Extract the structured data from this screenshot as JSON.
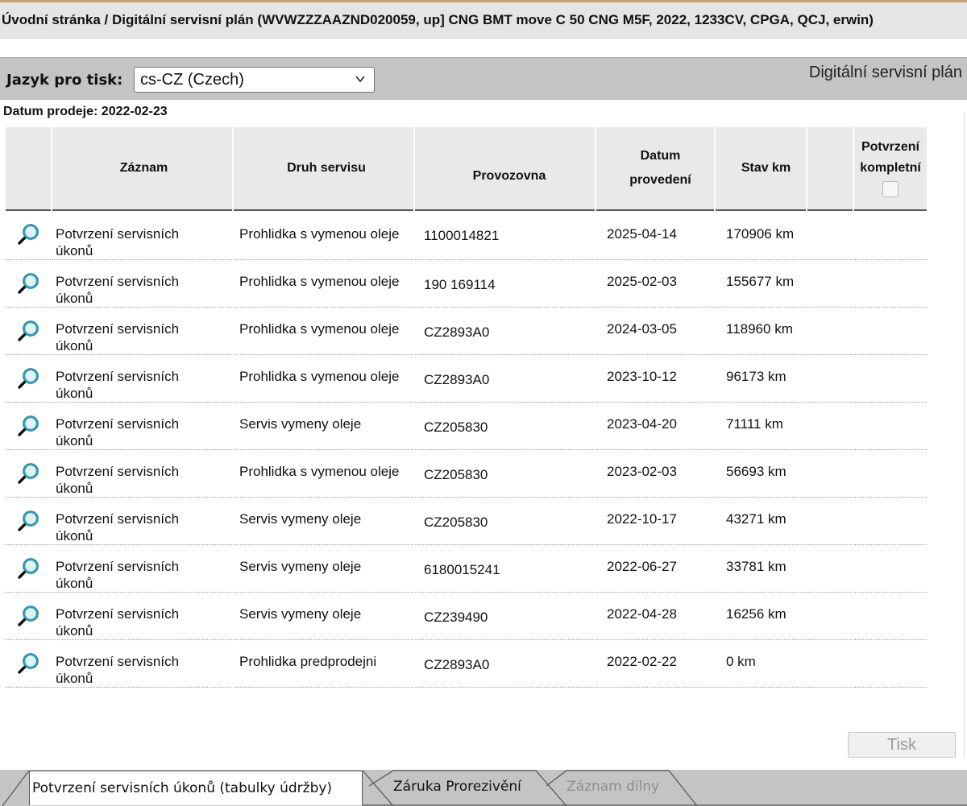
{
  "title": "Úvodní stránka / Digitální servisní plán (WVWZZZAAZND020059, up] CNG BMT move C 50 CNG M5F, 2022, 1233CV, CPGA, QCJ, erwin)",
  "toolbar": {
    "language_label": "Jazyk pro tisk:",
    "language_value": "cs-CZ (Czech)",
    "plan_title": "Digitální servisní plán"
  },
  "sale_date": "Datum prodeje: 2022-02-23",
  "table": {
    "headers": {
      "record": "Záznam",
      "service_type": "Druh servisu",
      "workshop": "Provozovna",
      "date_l1": "Datum",
      "date_l2": "provedení",
      "mileage": "Stav km",
      "confirm_l1": "Potvrzení",
      "confirm_l2": "kompletní"
    },
    "rows": [
      {
        "record_l1": "Potvrzení servisních",
        "record_l2": "úkonů",
        "service_type": "Prohlidka s vymenou oleje",
        "workshop": "1100014821",
        "date": "2025-04-14",
        "mileage": "170906 km"
      },
      {
        "record_l1": "Potvrzení servisních",
        "record_l2": "úkonů",
        "service_type": "Prohlidka s vymenou oleje",
        "workshop": "190 169114",
        "date": "2025-02-03",
        "mileage": "155677 km"
      },
      {
        "record_l1": "Potvrzení servisních",
        "record_l2": "úkonů",
        "service_type": "Prohlidka s vymenou oleje",
        "workshop": "CZ2893A0",
        "date": "2024-03-05",
        "mileage": "118960 km"
      },
      {
        "record_l1": "Potvrzení servisních",
        "record_l2": "úkonů",
        "service_type": "Prohlidka s vymenou oleje",
        "workshop": "CZ2893A0",
        "date": "2023-10-12",
        "mileage": "96173 km"
      },
      {
        "record_l1": "Potvrzení servisních",
        "record_l2": "úkonů",
        "service_type": "Servis vymeny oleje",
        "workshop": "CZ205830",
        "date": "2023-04-20",
        "mileage": "71111 km"
      },
      {
        "record_l1": "Potvrzení servisních",
        "record_l2": "úkonů",
        "service_type": "Prohlidka s vymenou oleje",
        "workshop": "CZ205830",
        "date": "2023-02-03",
        "mileage": "56693 km"
      },
      {
        "record_l1": "Potvrzení servisních",
        "record_l2": "úkonů",
        "service_type": "Servis vymeny oleje",
        "workshop": "CZ205830",
        "date": "2022-10-17",
        "mileage": "43271 km"
      },
      {
        "record_l1": "Potvrzení servisních",
        "record_l2": "úkonů",
        "service_type": "Servis vymeny oleje",
        "workshop": "6180015241",
        "date": "2022-06-27",
        "mileage": "33781 km"
      },
      {
        "record_l1": "Potvrzení servisních",
        "record_l2": "úkonů",
        "service_type": "Servis vymeny oleje",
        "workshop": "CZ239490",
        "date": "2022-04-28",
        "mileage": "16256 km"
      },
      {
        "record_l1": "Potvrzení servisních",
        "record_l2": "úkonů",
        "service_type": "Prohlidka predprodejni",
        "workshop": "CZ2893A0",
        "date": "2022-02-22",
        "mileage": "0 km"
      }
    ]
  },
  "print_button": "Tisk",
  "tabs": [
    {
      "label": "Potvrzení servisních úkonů (tabulky údržby)",
      "state": "active"
    },
    {
      "label": "Záruka Prorezivění",
      "state": "enabled"
    },
    {
      "label": "Záznam dílny",
      "state": "disabled"
    }
  ],
  "icons": {
    "row_view": "magnifier-icon",
    "language_dropdown": "chevron-down-icon"
  },
  "colors": {
    "toolbar_bg": "#c4c4c4",
    "header_bg": "#e9e9e9",
    "magnifier_lens": "#2fa4b9"
  }
}
